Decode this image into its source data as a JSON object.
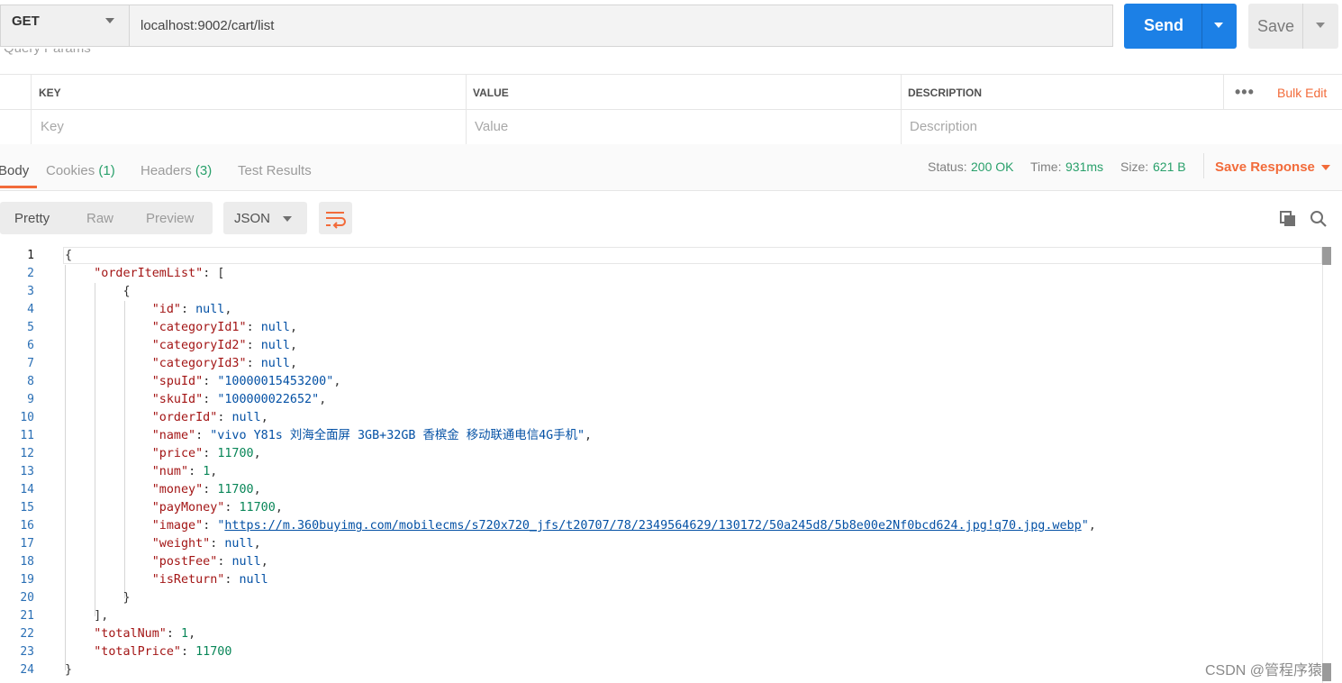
{
  "request": {
    "method": "GET",
    "url": "localhost:9002/cart/list",
    "send_label": "Send",
    "save_label": "Save"
  },
  "params": {
    "section_label": "Query Params",
    "columns": [
      "KEY",
      "VALUE",
      "DESCRIPTION"
    ],
    "placeholders": [
      "Key",
      "Value",
      "Description"
    ],
    "more_icon": "ellipsis-icon",
    "bulk_edit": "Bulk Edit"
  },
  "response": {
    "tabs": [
      {
        "label": "Body",
        "count": ""
      },
      {
        "label": "Cookies",
        "count": "(1)"
      },
      {
        "label": "Headers",
        "count": "(3)"
      },
      {
        "label": "Test Results",
        "count": ""
      }
    ],
    "status_label": "Status:",
    "status_value": "200 OK",
    "time_label": "Time:",
    "time_value": "931ms",
    "size_label": "Size:",
    "size_value": "621 B",
    "save_response": "Save Response"
  },
  "viewer": {
    "views": [
      "Pretty",
      "Raw",
      "Preview"
    ],
    "format": "JSON",
    "wrap_icon": "wrap-lines-icon",
    "copy_icon": "copy-icon",
    "search_icon": "search-icon"
  },
  "body": {
    "line_numbers": [
      "1",
      "2",
      "3",
      "4",
      "5",
      "6",
      "7",
      "8",
      "9",
      "10",
      "11",
      "12",
      "13",
      "14",
      "15",
      "16",
      "17",
      "18",
      "19",
      "20",
      "21",
      "22",
      "23",
      "24"
    ],
    "lines": [
      "{",
      "    \"orderItemList\": [",
      "        {",
      "            \"id\": null,",
      "            \"categoryId1\": null,",
      "            \"categoryId2\": null,",
      "            \"categoryId3\": null,",
      "            \"spuId\": \"10000015453200\",",
      "            \"skuId\": \"100000022652\",",
      "            \"orderId\": null,",
      "            \"name\": \"vivo Y81s 刘海全面屏 3GB+32GB 香槟金 移动联通电信4G手机\",",
      "            \"price\": 11700,",
      "            \"num\": 1,",
      "            \"money\": 11700,",
      "            \"payMoney\": 11700,",
      "            \"image\": \"https://m.360buyimg.com/mobilecms/s720x720_jfs/t20707/78/2349564629/130172/50a245d8/5b8e00e2Nf0bcd624.jpg!q70.jpg.webp\",",
      "            \"weight\": null,",
      "            \"postFee\": null,",
      "            \"isReturn\": null",
      "        }",
      "    ],",
      "    \"totalNum\": 1,",
      "    \"totalPrice\": 11700",
      "}"
    ]
  },
  "watermark": "CSDN @管程序猿"
}
